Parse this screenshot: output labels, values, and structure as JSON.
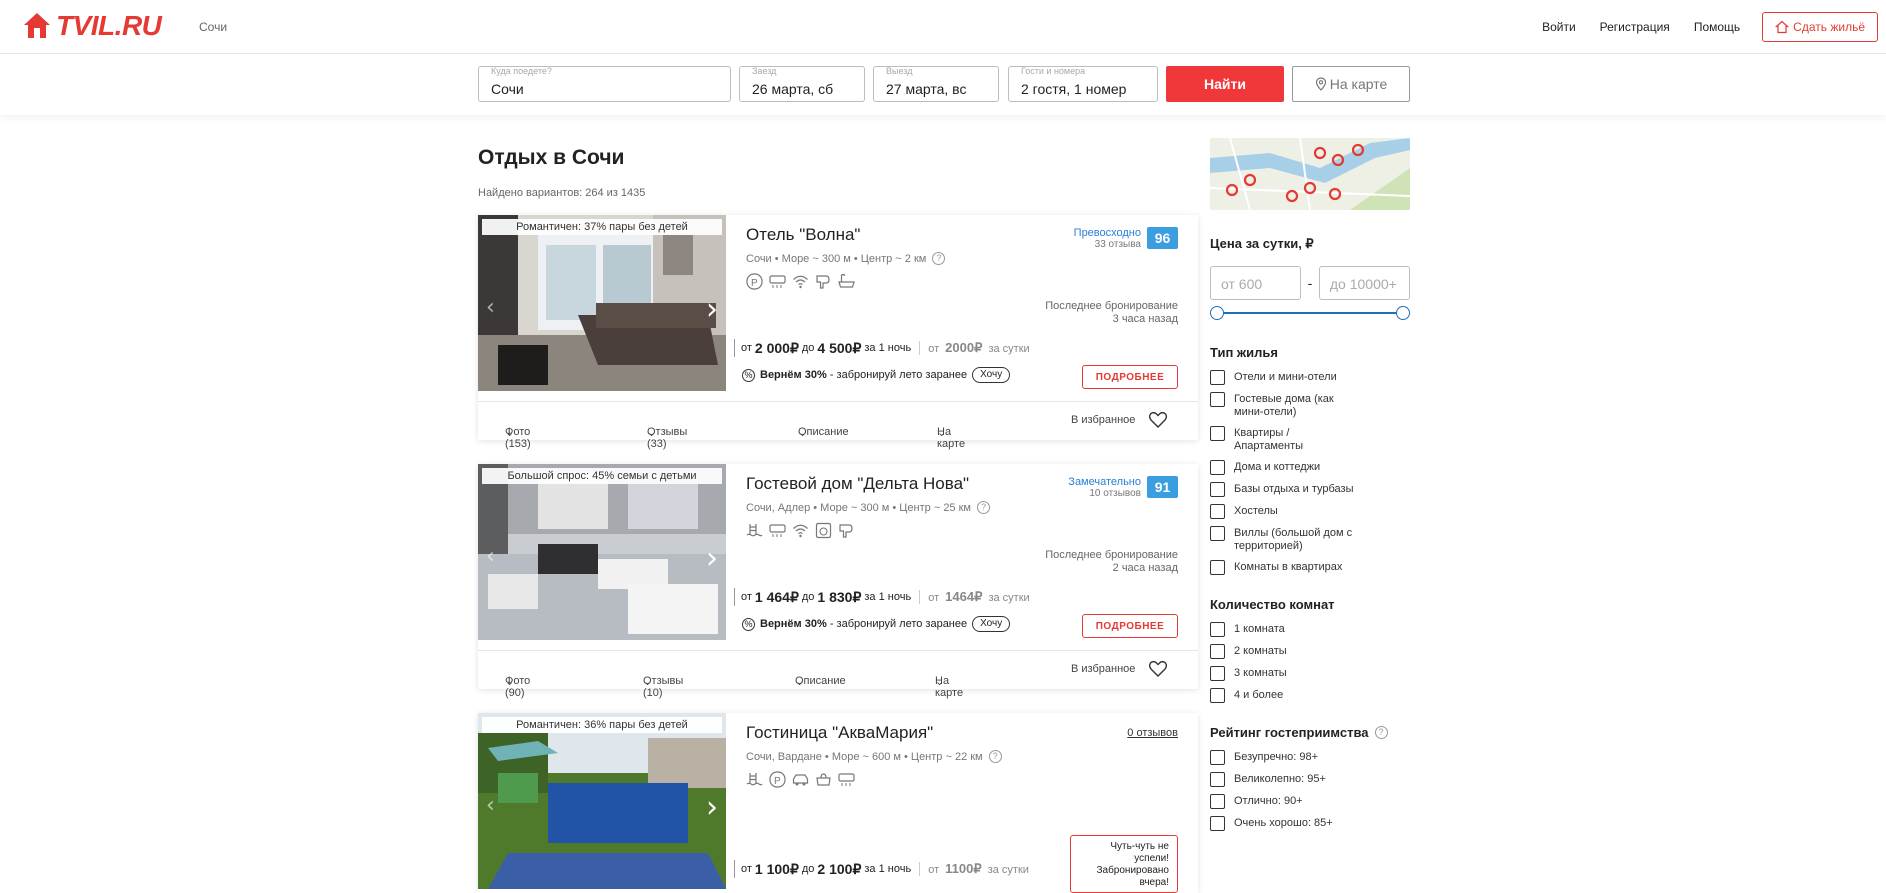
{
  "header": {
    "logo": "TVIL.RU",
    "city": "Сочи",
    "nav": {
      "login": "Войти",
      "register": "Регистрация",
      "help": "Помощь",
      "rent": "Сдать жильё"
    }
  },
  "search": {
    "where_label": "Куда поедете?",
    "where_value": "Сочи",
    "checkin_label": "Заезд",
    "checkin_value": "26 марта, сб",
    "checkout_label": "Выезд",
    "checkout_value": "27 марта, вс",
    "guests_label": "Гости и номера",
    "guests_value": "2 гостя, 1 номер",
    "find_button": "Найти",
    "map_button": "На карте"
  },
  "main": {
    "title": "Отдых в Сочи",
    "found": "Найдено вариантов: 264 из 1435"
  },
  "listings": [
    {
      "badge": "Романтичен: 37% пары без детей",
      "name": "Отель \"Волна\"",
      "location": "Сочи • Море ~ 300 м  • Центр ~ 2 км",
      "rating_word": "Превосходно",
      "reviews": "33 отзыва",
      "score": "96",
      "last_booking_1": "Последнее бронирование",
      "last_booking_2": "3 часа назад",
      "price_from_label": "от",
      "price_from": "2 000₽",
      "price_to_label": "до",
      "price_to": "4 500₽",
      "price_period": "за 1 ночь",
      "per_day_from": "от",
      "per_day_value": "2000₽",
      "per_day_label": "за сутки",
      "promo_bold": "Вернём 30%",
      "promo_text": " - забронируй лето заранее",
      "want": "Хочу",
      "more": "ПОДРОБНЕЕ",
      "tabs": {
        "photos": "Фото (153)",
        "reviews": "Отзывы (33)",
        "desc": "Описание",
        "map": "На карте",
        "fav": "В избранное"
      }
    },
    {
      "badge": "Большой спрос: 45% семьи с детьми",
      "name": "Гостевой дом \"Дельта Нова\"",
      "location": "Сочи, Адлер • Море ~ 300 м  • Центр ~ 25 км",
      "rating_word": "Замечательно",
      "reviews": "10 отзывов",
      "score": "91",
      "last_booking_1": "Последнее бронирование",
      "last_booking_2": "2 часа назад",
      "price_from_label": "от",
      "price_from": "1 464₽",
      "price_to_label": "до",
      "price_to": "1 830₽",
      "price_period": "за 1 ночь",
      "per_day_from": "от",
      "per_day_value": "1464₽",
      "per_day_label": "за сутки",
      "promo_bold": "Вернём 30%",
      "promo_text": " - забронируй лето заранее",
      "want": "Хочу",
      "more": "ПОДРОБНЕЕ",
      "tabs": {
        "photos": "Фото (90)",
        "reviews": "Отзывы (10)",
        "desc": "Описание",
        "map": "На карте",
        "fav": "В избранное"
      }
    },
    {
      "badge": "Романтичен: 36% пары без детей",
      "name": "Гостиница \"АкваМария\"",
      "location": "Сочи, Вардане • Море ~ 600 м  • Центр ~ 22 км",
      "reviews_link": "0 отзывов",
      "sold_1": "Чуть-чуть не",
      "sold_2": "успели!",
      "sold_3": "Забронировано",
      "sold_4": "вчера!",
      "price_from_label": "от",
      "price_from": "1 100₽",
      "price_to_label": "до",
      "price_to": "2 100₽",
      "price_period": "за 1 ночь",
      "per_day_from": "от",
      "per_day_value": "1100₽",
      "per_day_label": "за сутки"
    }
  ],
  "sidebar": {
    "price_title": "Цена за сутки, ₽",
    "price_from_placeholder": "от 600",
    "price_to_placeholder": "до 10000+",
    "price_dash": "-",
    "type_title": "Тип жилья",
    "types": [
      "Отели и мини-отели",
      "Гостевые дома (как мини-отели)",
      "Квартиры / Апартаменты",
      "Дома и коттеджи",
      "Базы отдыха и турбазы",
      "Хостелы",
      "Виллы (большой дом с территорией)",
      "Комнаты в квартирах"
    ],
    "rooms_title": "Количество комнат",
    "rooms": [
      "1 комната",
      "2 комнаты",
      "3 комнаты",
      "4 и более"
    ],
    "rating_title": "Рейтинг гостеприимства",
    "ratings": [
      "Безупречно: 98+",
      "Великолепно: 95+",
      "Отлично: 90+",
      "Очень хорошо: 85+"
    ]
  },
  "colors": {
    "brand_red": "#e43a33",
    "button_red": "#f0383a",
    "rating_blue": "#3a9ee0",
    "slider_blue": "#1e6fb8"
  }
}
